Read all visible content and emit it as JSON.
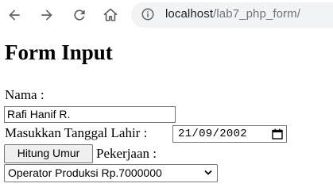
{
  "browser": {
    "url_host": "localhost",
    "url_path": "/lab7_php_form/"
  },
  "page": {
    "title": "Form Input"
  },
  "form": {
    "nama_label": "Nama :",
    "nama_value": "Rafi Hanif R.",
    "tanggal_label": "Masukkan Tanggal Lahir :",
    "tanggal_value": "21/09/2002",
    "hitung_button": "Hitung Umur",
    "pekerjaan_label": "Pekerjaan :",
    "pekerjaan_selected": "Operator Produksi Rp.7000000"
  }
}
